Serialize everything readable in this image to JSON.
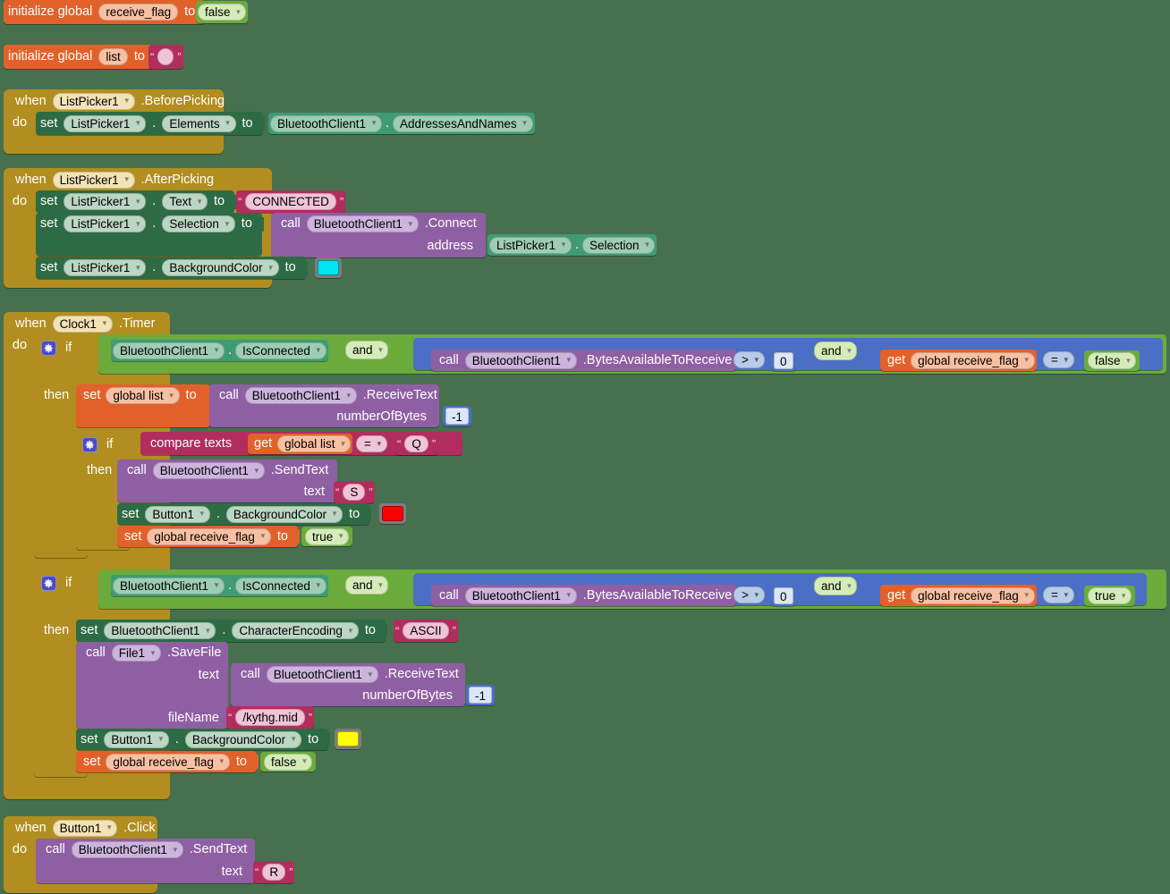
{
  "workspace": {
    "background_color": "#47704e",
    "app": "MIT App Inventor Blocks Editor"
  },
  "palette": {
    "event_block_color": "#b18e1f",
    "setter_block_color": "#2d6b45",
    "getter_block_color": "#3e9b74",
    "procedure_call_color": "#8f5fa3",
    "logic_block_color": "#6aab3c",
    "variable_block_color": "#e2612a",
    "text_block_color": "#b32c5e",
    "math_block_color": "#4a6fc4",
    "color_block_color": "#7c7c82"
  },
  "blocks": {
    "init_receive_flag": {
      "keyword": "initialize global",
      "name": "receive_flag",
      "to": "to",
      "value": "false"
    },
    "init_list": {
      "keyword": "initialize global",
      "name": "list",
      "to": "to",
      "value": ""
    },
    "listpicker_beforepicking": {
      "when": "when",
      "component": "ListPicker1",
      "event": ".BeforePicking",
      "do": "do",
      "statement": {
        "set": "set",
        "component": "ListPicker1",
        "dot": ".",
        "property": "Elements",
        "to": "to",
        "value_component": "BluetoothClient1",
        "value_property": "AddressesAndNames"
      }
    },
    "listpicker_afterpicking": {
      "when": "when",
      "component": "ListPicker1",
      "event": ".AfterPicking",
      "do": "do",
      "set_text": {
        "set": "set",
        "component": "ListPicker1",
        "dot": ".",
        "property": "Text",
        "to": "to",
        "text_value": "CONNECTED"
      },
      "set_selection": {
        "set": "set",
        "component": "ListPicker1",
        "dot": ".",
        "property": "Selection",
        "to": "to",
        "call": "call",
        "call_component": "BluetoothClient1",
        "call_method": ".Connect",
        "arg_name": "address",
        "arg_component": "ListPicker1",
        "arg_property": "Selection"
      },
      "set_bgcolor": {
        "set": "set",
        "component": "ListPicker1",
        "dot": ".",
        "property": "BackgroundColor",
        "to": "to",
        "color": "#00e5ee"
      }
    },
    "clock1_timer": {
      "when": "when",
      "component": "Clock1",
      "event": ".Timer",
      "do": "do",
      "if1": {
        "if": "if",
        "then": "then",
        "cond_component": "BluetoothClient1",
        "cond_property": "IsConnected",
        "and1": "and",
        "call": "call",
        "call_component": "BluetoothClient1",
        "call_method": ".BytesAvailableToReceive",
        "gt_op": ">",
        "gt_value": "0",
        "and2": "and",
        "get": "get",
        "get_var": "global receive_flag",
        "eq_op": "=",
        "eq_value": "false",
        "then_set_list": {
          "set": "set",
          "var": "global list",
          "to": "to",
          "call": "call",
          "call_component": "BluetoothClient1",
          "call_method": ".ReceiveText",
          "arg_name": "numberOfBytes",
          "arg_value": "-1"
        },
        "inner_if": {
          "if": "if",
          "then": "then",
          "compare": "compare texts",
          "get": "get",
          "get_var": "global list",
          "op": "=",
          "text_value": "Q",
          "send_text": {
            "call": "call",
            "component": "BluetoothClient1",
            "method": ".SendText",
            "arg_name": "text",
            "text_value": "S"
          },
          "set_button_bg": {
            "set": "set",
            "component": "Button1",
            "dot": ".",
            "property": "BackgroundColor",
            "to": "to",
            "color": "#ff0000"
          },
          "set_flag": {
            "set": "set",
            "var": "global receive_flag",
            "to": "to",
            "value": "true"
          }
        }
      },
      "if2": {
        "if": "if",
        "then": "then",
        "cond_component": "BluetoothClient1",
        "cond_property": "IsConnected",
        "and1": "and",
        "call": "call",
        "call_component": "BluetoothClient1",
        "call_method": ".BytesAvailableToReceive",
        "gt_op": ">",
        "gt_value": "0",
        "and2": "and",
        "get": "get",
        "get_var": "global receive_flag",
        "eq_op": "=",
        "eq_value": "true",
        "set_encoding": {
          "set": "set",
          "component": "BluetoothClient1",
          "dot": ".",
          "property": "CharacterEncoding",
          "to": "to",
          "text_value": "ASCII"
        },
        "save_file": {
          "call": "call",
          "component": "File1",
          "method": ".SaveFile",
          "text_arg": "text",
          "inner_call": "call",
          "inner_component": "BluetoothClient1",
          "inner_method": ".ReceiveText",
          "inner_arg_name": "numberOfBytes",
          "inner_arg_value": "-1",
          "filename_arg": "fileName",
          "filename_value": "/kythg.mid"
        },
        "set_button_bg": {
          "set": "set",
          "component": "Button1",
          "dot": ".",
          "property": "BackgroundColor",
          "to": "to",
          "color": "#ffff00"
        },
        "set_flag": {
          "set": "set",
          "var": "global receive_flag",
          "to": "to",
          "value": "false"
        }
      }
    },
    "button1_click": {
      "when": "when",
      "component": "Button1",
      "event": ".Click",
      "do": "do",
      "statement": {
        "call": "call",
        "component": "BluetoothClient1",
        "method": ".SendText",
        "arg_name": "text",
        "text_value": "R"
      }
    }
  }
}
